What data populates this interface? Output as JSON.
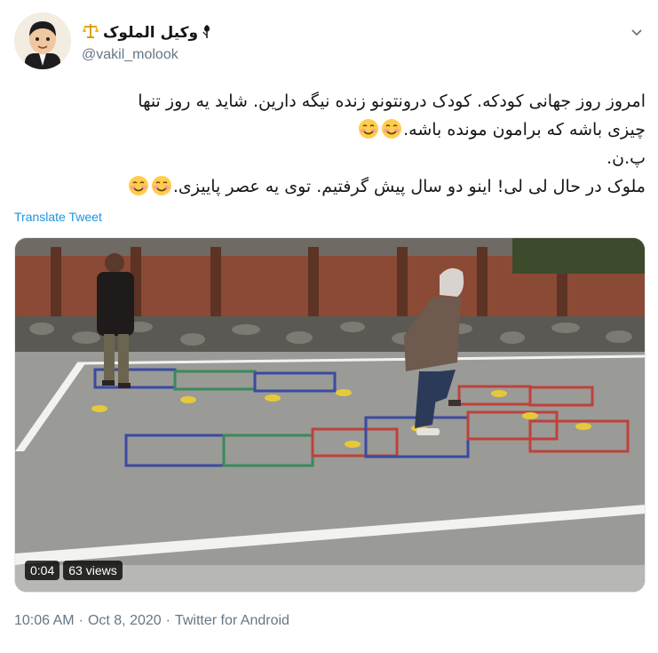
{
  "user": {
    "display_name": "وکیل الملوک",
    "handle": "@vakil_molook"
  },
  "tweet": {
    "line1": "امروز روز جهانی کودکه. کودک درونتونو زنده نیگه دارین. شاید یه روز تنها",
    "line2": "چیزی باشه که برامون مونده باشه.",
    "line3": "پ.ن.",
    "line4": "ملوک در حال لی لی! اینو دو سال پیش گرفتیم. توی یه عصر پاییزی.",
    "translate": "Translate Tweet"
  },
  "video": {
    "duration": "0:04",
    "views": "63 views"
  },
  "meta": {
    "time": "10:06 AM",
    "separator": "·",
    "date": "Oct 8, 2020",
    "source": "Twitter for Android"
  },
  "icons": {
    "scales": "scales-icon",
    "tulip": "tulip-icon",
    "caret": "chevron-down-icon",
    "smile": "smiling-face-emoji"
  },
  "colors": {
    "link": "#1b95e0",
    "secondary": "#657786"
  }
}
